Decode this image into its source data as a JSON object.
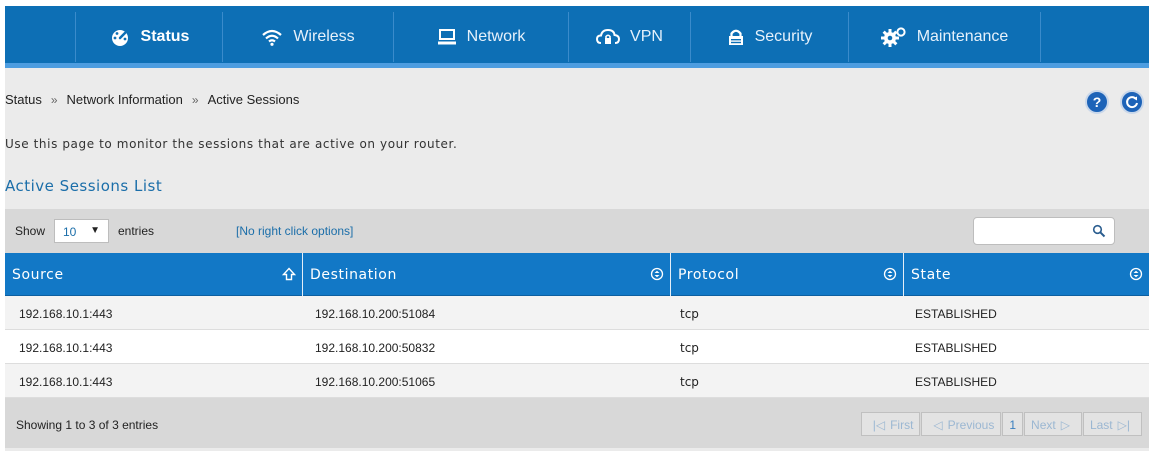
{
  "nav": {
    "items": [
      {
        "label": "Status",
        "icon": "dashboard-icon",
        "active": true
      },
      {
        "label": "Wireless",
        "icon": "wifi-icon"
      },
      {
        "label": "Network",
        "icon": "monitor-icon"
      },
      {
        "label": "VPN",
        "icon": "cloud-lock-icon"
      },
      {
        "label": "Security",
        "icon": "lock-icon"
      },
      {
        "label": "Maintenance",
        "icon": "gears-icon"
      }
    ]
  },
  "breadcrumb": [
    "Status",
    "Network Information",
    "Active Sessions"
  ],
  "breadcrumb_sep": "»",
  "help": "?",
  "description": "Use this page to monitor the sessions that are active on your router.",
  "section_title": "Active Sessions List",
  "toolbar": {
    "show": "Show",
    "page_size": "10",
    "entries": "entries",
    "no_right_click": "[No right click options]"
  },
  "table": {
    "headers": [
      "Source",
      "Destination",
      "Protocol",
      "State"
    ],
    "rows": [
      [
        "192.168.10.1:443",
        "192.168.10.200:51084",
        "tcp",
        "ESTABLISHED"
      ],
      [
        "192.168.10.1:443",
        "192.168.10.200:50832",
        "tcp",
        "ESTABLISHED"
      ],
      [
        "192.168.10.1:443",
        "192.168.10.200:51065",
        "tcp",
        "ESTABLISHED"
      ]
    ]
  },
  "footer": {
    "showing": "Showing 1 to 3 of 3 entries",
    "first": "First",
    "previous": "Previous",
    "page": "1",
    "next": "Next",
    "last": "Last"
  },
  "colors": {
    "nav": "#0d6fb5",
    "header": "#1278c6",
    "accent": "#1b6ea9"
  }
}
